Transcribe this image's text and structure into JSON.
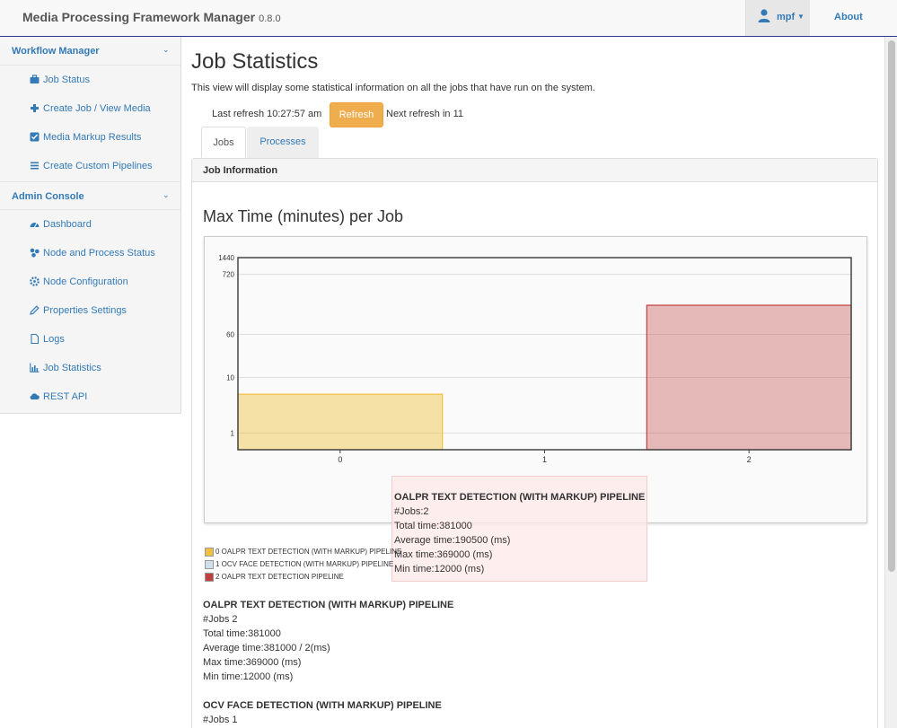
{
  "app": {
    "brand": "Media Processing Framework Manager",
    "version": "0.8.0"
  },
  "nav": {
    "user": "mpf",
    "about": "About"
  },
  "sidebar": {
    "sections": [
      {
        "title": "Workflow Manager",
        "items": [
          {
            "label": "Job Status",
            "icon": "briefcase-icon"
          },
          {
            "label": "Create Job / View Media",
            "icon": "plus-icon"
          },
          {
            "label": "Media Markup Results",
            "icon": "checkbox-icon"
          },
          {
            "label": "Create Custom Pipelines",
            "icon": "list-icon"
          }
        ]
      },
      {
        "title": "Admin Console",
        "items": [
          {
            "label": "Dashboard",
            "icon": "dashboard-icon"
          },
          {
            "label": "Node and Process Status",
            "icon": "nodes-icon"
          },
          {
            "label": "Node Configuration",
            "icon": "cog-icon"
          },
          {
            "label": "Properties Settings",
            "icon": "pencil-icon"
          },
          {
            "label": "Logs",
            "icon": "file-icon"
          },
          {
            "label": "Job Statistics",
            "icon": "chart-icon"
          },
          {
            "label": "REST API",
            "icon": "cloud-icon"
          }
        ]
      }
    ]
  },
  "main": {
    "title": "Job Statistics",
    "description": "This view will display some statistical information on all the jobs that have run on the system.",
    "last_refresh": "Last refresh 10:27:57 am",
    "refresh_button": "Refresh",
    "next_refresh": "Next refresh in 11",
    "tabs": [
      {
        "label": "Jobs",
        "active": true
      },
      {
        "label": "Processes",
        "active": false
      }
    ],
    "panel_title": "Job Information",
    "chart_title": "Max Time (minutes) per Job"
  },
  "chart_data": {
    "type": "bar",
    "title": "Max Time (minutes) per Job",
    "categories": [
      "0",
      "1",
      "2"
    ],
    "y_scale": "log",
    "y_ticks": [
      "1",
      "10",
      "60",
      "720",
      "1440"
    ],
    "values": [
      5,
      0,
      200
    ],
    "colors": [
      "#f0c040",
      "#a8c8e0",
      "#c04040"
    ],
    "legend": [
      "0 OALPR TEXT DETECTION (WITH MARKUP) PIPELINE",
      "1 OCV FACE DETECTION (WITH MARKUP) PIPELINE",
      "2 OALPR TEXT DETECTION PIPELINE"
    ],
    "tooltip": {
      "title": "OALPR TEXT DETECTION (WITH MARKUP) PIPELINE",
      "lines": [
        "#Jobs:2",
        "Total time:381000",
        "Average time:190500 (ms)",
        "Max time:369000 (ms)",
        "Min time:12000 (ms)"
      ]
    }
  },
  "summaries": [
    {
      "title": "OALPR TEXT DETECTION (WITH MARKUP) PIPELINE",
      "lines": [
        "#Jobs 2",
        "Total time:381000",
        "Average time:381000 / 2(ms)",
        "Max time:369000 (ms)",
        "Min time:12000 (ms)"
      ]
    },
    {
      "title": "OCV FACE DETECTION (WITH MARKUP) PIPELINE",
      "lines": [
        "#Jobs 1"
      ]
    }
  ]
}
